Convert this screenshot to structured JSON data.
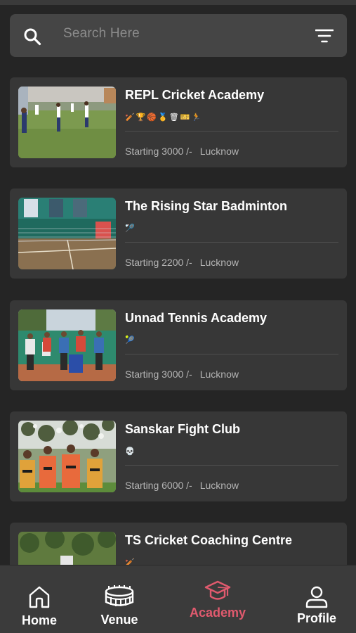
{
  "search": {
    "placeholder": "Search Here",
    "search_icon": "search-icon",
    "filter_icon": "filter-icon"
  },
  "academies": [
    {
      "title": "REPL Cricket Academy",
      "icons": [
        "cricket-bat-icon",
        "trophy-icon",
        "basketball-icon",
        "medal-icon",
        "bin-icon",
        "badge-icon",
        "runner-icon"
      ],
      "icon_glyphs": "🏏🏆🏀🥇🗑🎫🏃",
      "price": "Starting 3000 /-",
      "location": "Lucknow"
    },
    {
      "title": "The Rising Star Badminton",
      "icons": [
        "badminton-icon"
      ],
      "icon_glyphs": "🏸",
      "price": "Starting 2200 /-",
      "location": "Lucknow"
    },
    {
      "title": "Unnad Tennis Academy",
      "icons": [
        "tennis-ball-icon"
      ],
      "icon_glyphs": "🎾",
      "price": "Starting 3000 /-",
      "location": "Lucknow"
    },
    {
      "title": "Sanskar Fight Club",
      "icons": [
        "skull-icon"
      ],
      "icon_glyphs": "💀",
      "price": "Starting 6000 /-",
      "location": "Lucknow"
    },
    {
      "title": "TS Cricket Coaching Centre",
      "icons": [
        "cricket-bat-icon"
      ],
      "icon_glyphs": "🏏",
      "price": "",
      "location": ""
    }
  ],
  "nav": {
    "items": [
      {
        "label": "Home",
        "icon": "home-icon",
        "active": false
      },
      {
        "label": "Venue",
        "icon": "stadium-icon",
        "active": false
      },
      {
        "label": "Academy",
        "icon": "graduation-cap-icon",
        "active": true
      },
      {
        "label": "Profile",
        "icon": "user-icon",
        "active": false
      }
    ]
  },
  "colors": {
    "background": "#252525",
    "card": "#373737",
    "search": "#454545",
    "nav": "#3b3b3b",
    "accent": "#e05a6e"
  }
}
